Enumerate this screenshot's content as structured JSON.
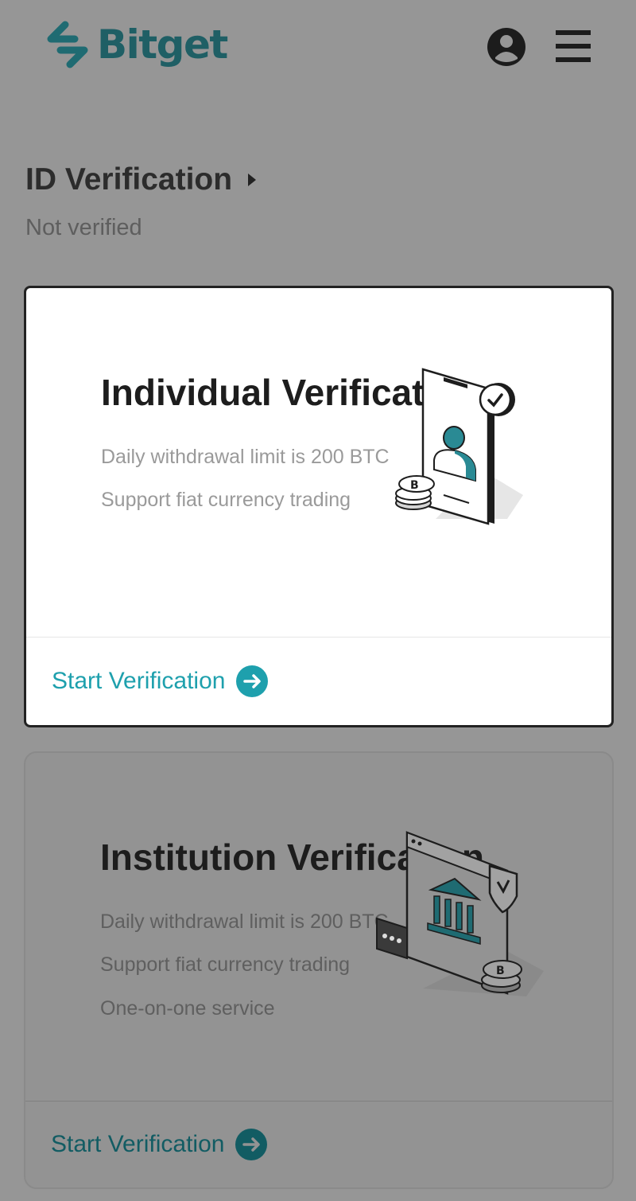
{
  "header": {
    "brand_name": "Bitget",
    "brand_color": "#1f5f65",
    "avatar_icon": "user-circle-icon",
    "menu_icon": "hamburger-menu-icon"
  },
  "verification": {
    "title": "ID Verification",
    "status": "Not verified"
  },
  "cards": [
    {
      "title": "Individual Verification",
      "features": [
        "Daily withdrawal limit is 200 BTC",
        "Support fiat currency trading"
      ],
      "cta": "Start Verification",
      "cta_icon": "arrow-right-circle-icon",
      "illustration": "phone-id-illustration"
    },
    {
      "title": "Institution Verification",
      "features": [
        "Daily withdrawal limit is 200 BTC",
        "Support fiat currency trading",
        "One-on-one service"
      ],
      "cta": "Start Verification",
      "cta_icon": "arrow-right-circle-icon",
      "illustration": "institution-bank-illustration"
    }
  ],
  "colors": {
    "accent": "#1ea0ad",
    "overlay": "#969696"
  }
}
